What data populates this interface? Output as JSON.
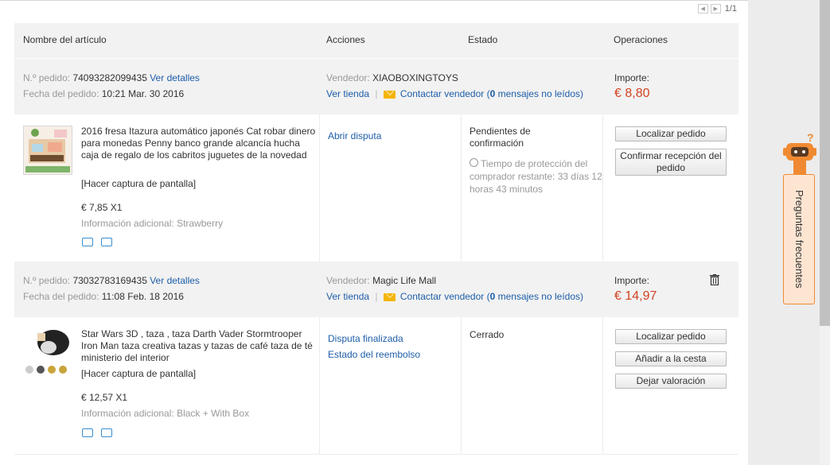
{
  "pager": {
    "text": "1/1"
  },
  "table_header": {
    "col_item": "Nombre del artículo",
    "col_actions": "Acciones",
    "col_status": "Estado",
    "col_operations": "Operaciones"
  },
  "orders": [
    {
      "order_no_label": "N.º pedido:",
      "order_no": "74093282099435",
      "details_link": "Ver detalles",
      "date_label": "Fecha del pedido:",
      "date": "10:21 Mar. 30 2016",
      "seller_label": "Vendedor:",
      "seller": "XIAOBOXINGTOYS",
      "store_link": "Ver tienda",
      "sep": "|",
      "contact_link": "Contactar vendedor (",
      "unread_count": "0",
      "unread_text": " mensajes no leídos)",
      "amount_label": "Importe:",
      "amount": "€ 8,80",
      "product_title": "2016 fresa Itazura automático japonés Cat robar dinero para monedas Penny banco grande alcancía hucha caja de regalo de los cabritos juguetes de la novedad",
      "screenshot": "[Hacer captura de pantalla]",
      "price_qty": "€ 7,85 X1",
      "extra_info": "Información adicional: Strawberry",
      "actions": [
        "Abrir disputa"
      ],
      "status": "Pendientes de confirmación",
      "timer": "Tiempo de protección del comprador restante: 33 días 12 horas 43 minutos",
      "buttons": [
        "Localizar pedido",
        "Confirmar recepción del pedido"
      ]
    },
    {
      "order_no_label": "N.º pedido:",
      "order_no": "73032783169435",
      "details_link": "Ver detalles",
      "date_label": "Fecha del pedido:",
      "date": "11:08 Feb. 18 2016",
      "seller_label": "Vendedor:",
      "seller": "Magic Life Mall",
      "store_link": "Ver tienda",
      "sep": "|",
      "contact_link": "Contactar vendedor (",
      "unread_count": "0",
      "unread_text": " mensajes no leídos)",
      "amount_label": "Importe:",
      "amount": "€ 14,97",
      "product_title": "Star Wars 3D , taza , taza Darth Vader Stormtrooper Iron Man taza creativa tazas y tazas de café taza de té ministerio del interior",
      "screenshot": "[Hacer captura de pantalla]",
      "price_qty": "€ 12,57 X1",
      "extra_info": "Información adicional: Black + With Box",
      "actions": [
        "Disputa finalizada",
        "Estado del reembolso"
      ],
      "status": "Cerrado",
      "buttons": [
        "Localizar pedido",
        "Añadir a la cesta",
        "Dejar valoración"
      ]
    }
  ],
  "faq": {
    "label": "Preguntas frecuentes"
  },
  "colors": {
    "price": "#d14424",
    "link": "#1e5ea8",
    "faq_bg": "#fde5d2",
    "faq_border": "#f08a32"
  }
}
